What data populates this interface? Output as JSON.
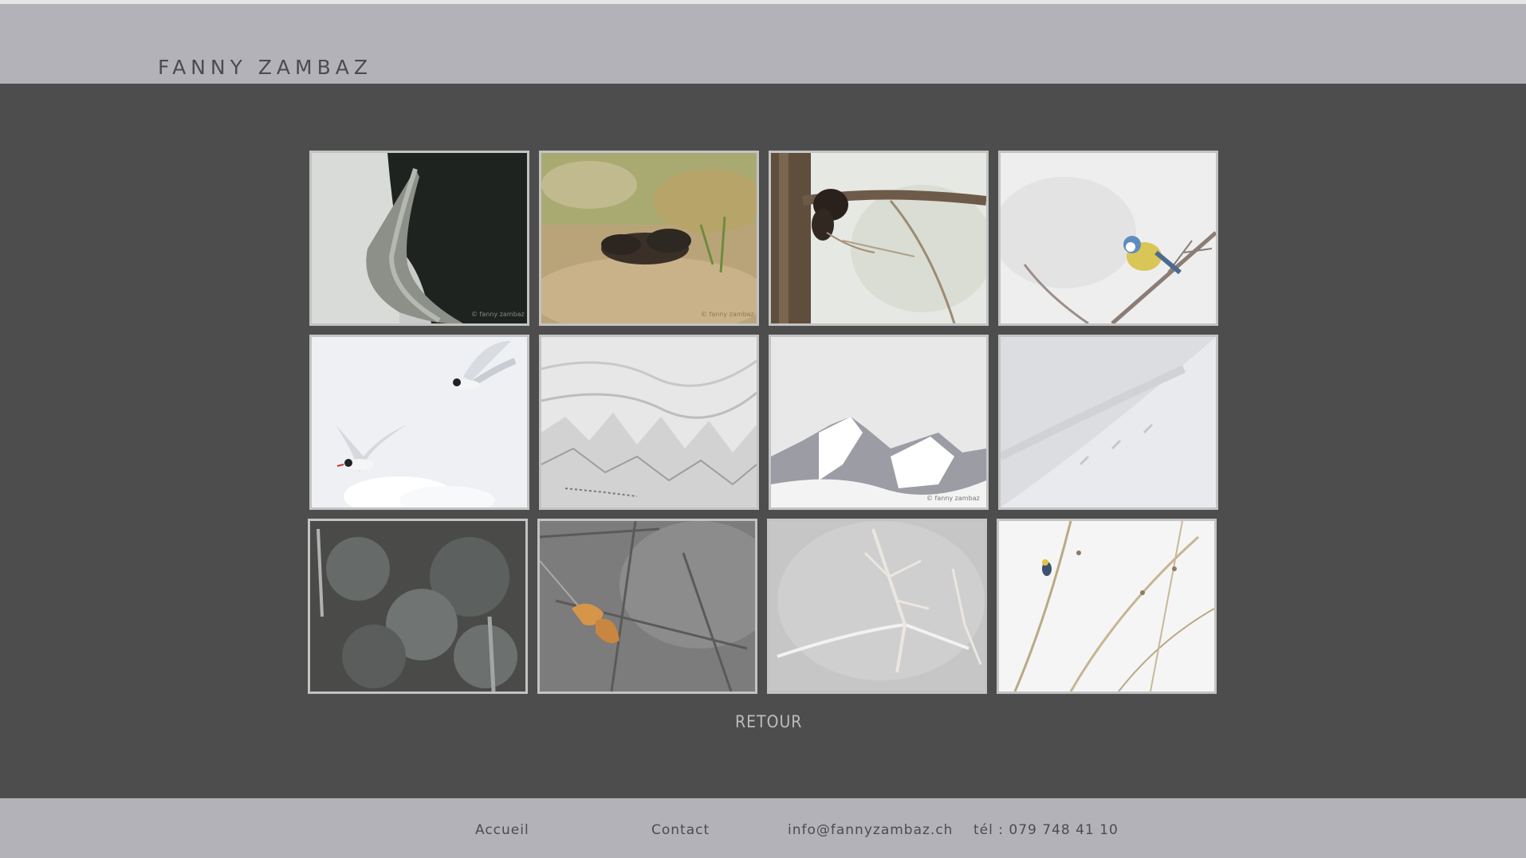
{
  "header": {
    "brand": "FANNY ZAMBAZ"
  },
  "gallery": {
    "watermark": "© fanny zambaz",
    "back_label": "RETOUR"
  },
  "footer": {
    "home_label": "Accueil",
    "contact_label": "Contact",
    "email": "info@fannyzambaz.ch",
    "phone": "tél : 079 748 41 10"
  }
}
